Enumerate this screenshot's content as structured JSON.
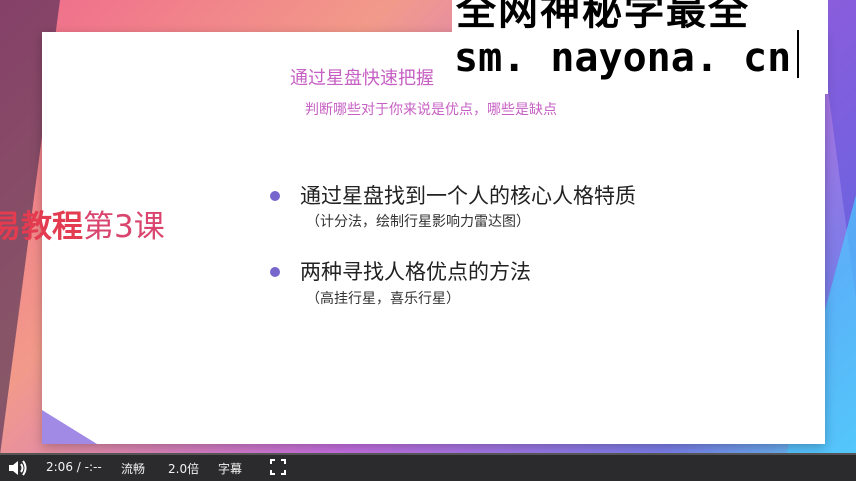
{
  "slide": {
    "title": "通过星盘快速把握",
    "subtitle": "判断哪些对于你来说是优点，哪些是缺点",
    "bullets": [
      {
        "text": "通过星盘找到一个人的核心人格特质",
        "note": "（计分法，绘制行星影响力雷达图）"
      },
      {
        "text": "两种寻找人格优点的方法",
        "note": "（高挂行星，喜乐行星）"
      }
    ]
  },
  "overlay_left": {
    "part1": "易教程",
    "part2": "第3课"
  },
  "watermark": {
    "line1": "全网神秘学最全",
    "url": "sm. nayona. cn"
  },
  "player": {
    "time": "2:06 / -:--",
    "quality": "流畅",
    "speed": "2.0倍",
    "subtitles": "字幕",
    "progress": 0.0,
    "icons": {
      "volume": "volume-icon",
      "fullscreen": "fullscreen-icon"
    }
  }
}
